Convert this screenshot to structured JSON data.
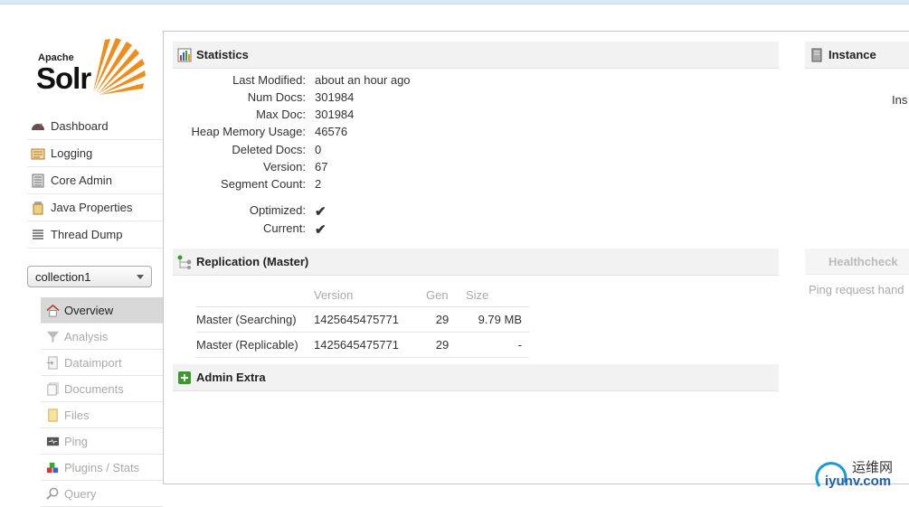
{
  "logo": {
    "apache": "Apache",
    "solr": "Solr"
  },
  "nav": [
    {
      "label": "Dashboard",
      "icon": "dashboard-icon"
    },
    {
      "label": "Logging",
      "icon": "logging-icon"
    },
    {
      "label": "Core Admin",
      "icon": "core-admin-icon"
    },
    {
      "label": "Java Properties",
      "icon": "java-properties-icon"
    },
    {
      "label": "Thread Dump",
      "icon": "thread-dump-icon"
    }
  ],
  "core_selector": {
    "value": "collection1"
  },
  "core_menu": [
    {
      "label": "Overview",
      "icon": "home-icon",
      "active": true
    },
    {
      "label": "Analysis",
      "icon": "funnel-icon"
    },
    {
      "label": "Dataimport",
      "icon": "dataimport-icon"
    },
    {
      "label": "Documents",
      "icon": "documents-icon"
    },
    {
      "label": "Files",
      "icon": "files-icon"
    },
    {
      "label": "Ping",
      "icon": "ping-icon"
    },
    {
      "label": "Plugins / Stats",
      "icon": "plugins-icon"
    },
    {
      "label": "Query",
      "icon": "query-icon"
    }
  ],
  "statistics": {
    "title": "Statistics",
    "rows": [
      {
        "key": "Last Modified:",
        "value": "about an hour ago"
      },
      {
        "key": "Num Docs:",
        "value": "301984"
      },
      {
        "key": "Max Doc:",
        "value": "301984"
      },
      {
        "key": "Heap Memory Usage:",
        "value": "46576"
      },
      {
        "key": "Deleted Docs:",
        "value": "0"
      },
      {
        "key": "Version:",
        "value": "67"
      },
      {
        "key": "Segment Count:",
        "value": "2"
      }
    ],
    "flags": [
      {
        "key": "Optimized:",
        "value": "✔"
      },
      {
        "key": "Current:",
        "value": "✔"
      }
    ]
  },
  "replication": {
    "title": "Replication (Master)",
    "headers": [
      "",
      "Version",
      "Gen",
      "Size"
    ],
    "rows": [
      [
        "Master (Searching)",
        "1425645475771",
        "29",
        "9.79 MB"
      ],
      [
        "Master (Replicable)",
        "1425645475771",
        "29",
        "-"
      ]
    ]
  },
  "admin_extra": {
    "title": "Admin Extra"
  },
  "instance": {
    "title": "Instance",
    "label": "Ins"
  },
  "healthcheck": {
    "title": "Healthcheck",
    "text": "Ping request hand"
  },
  "watermark": {
    "line1": "运维网",
    "line2": "iyunv.com"
  },
  "colors": {
    "check": "#3a9a2a",
    "accent": "#f08c1a"
  }
}
